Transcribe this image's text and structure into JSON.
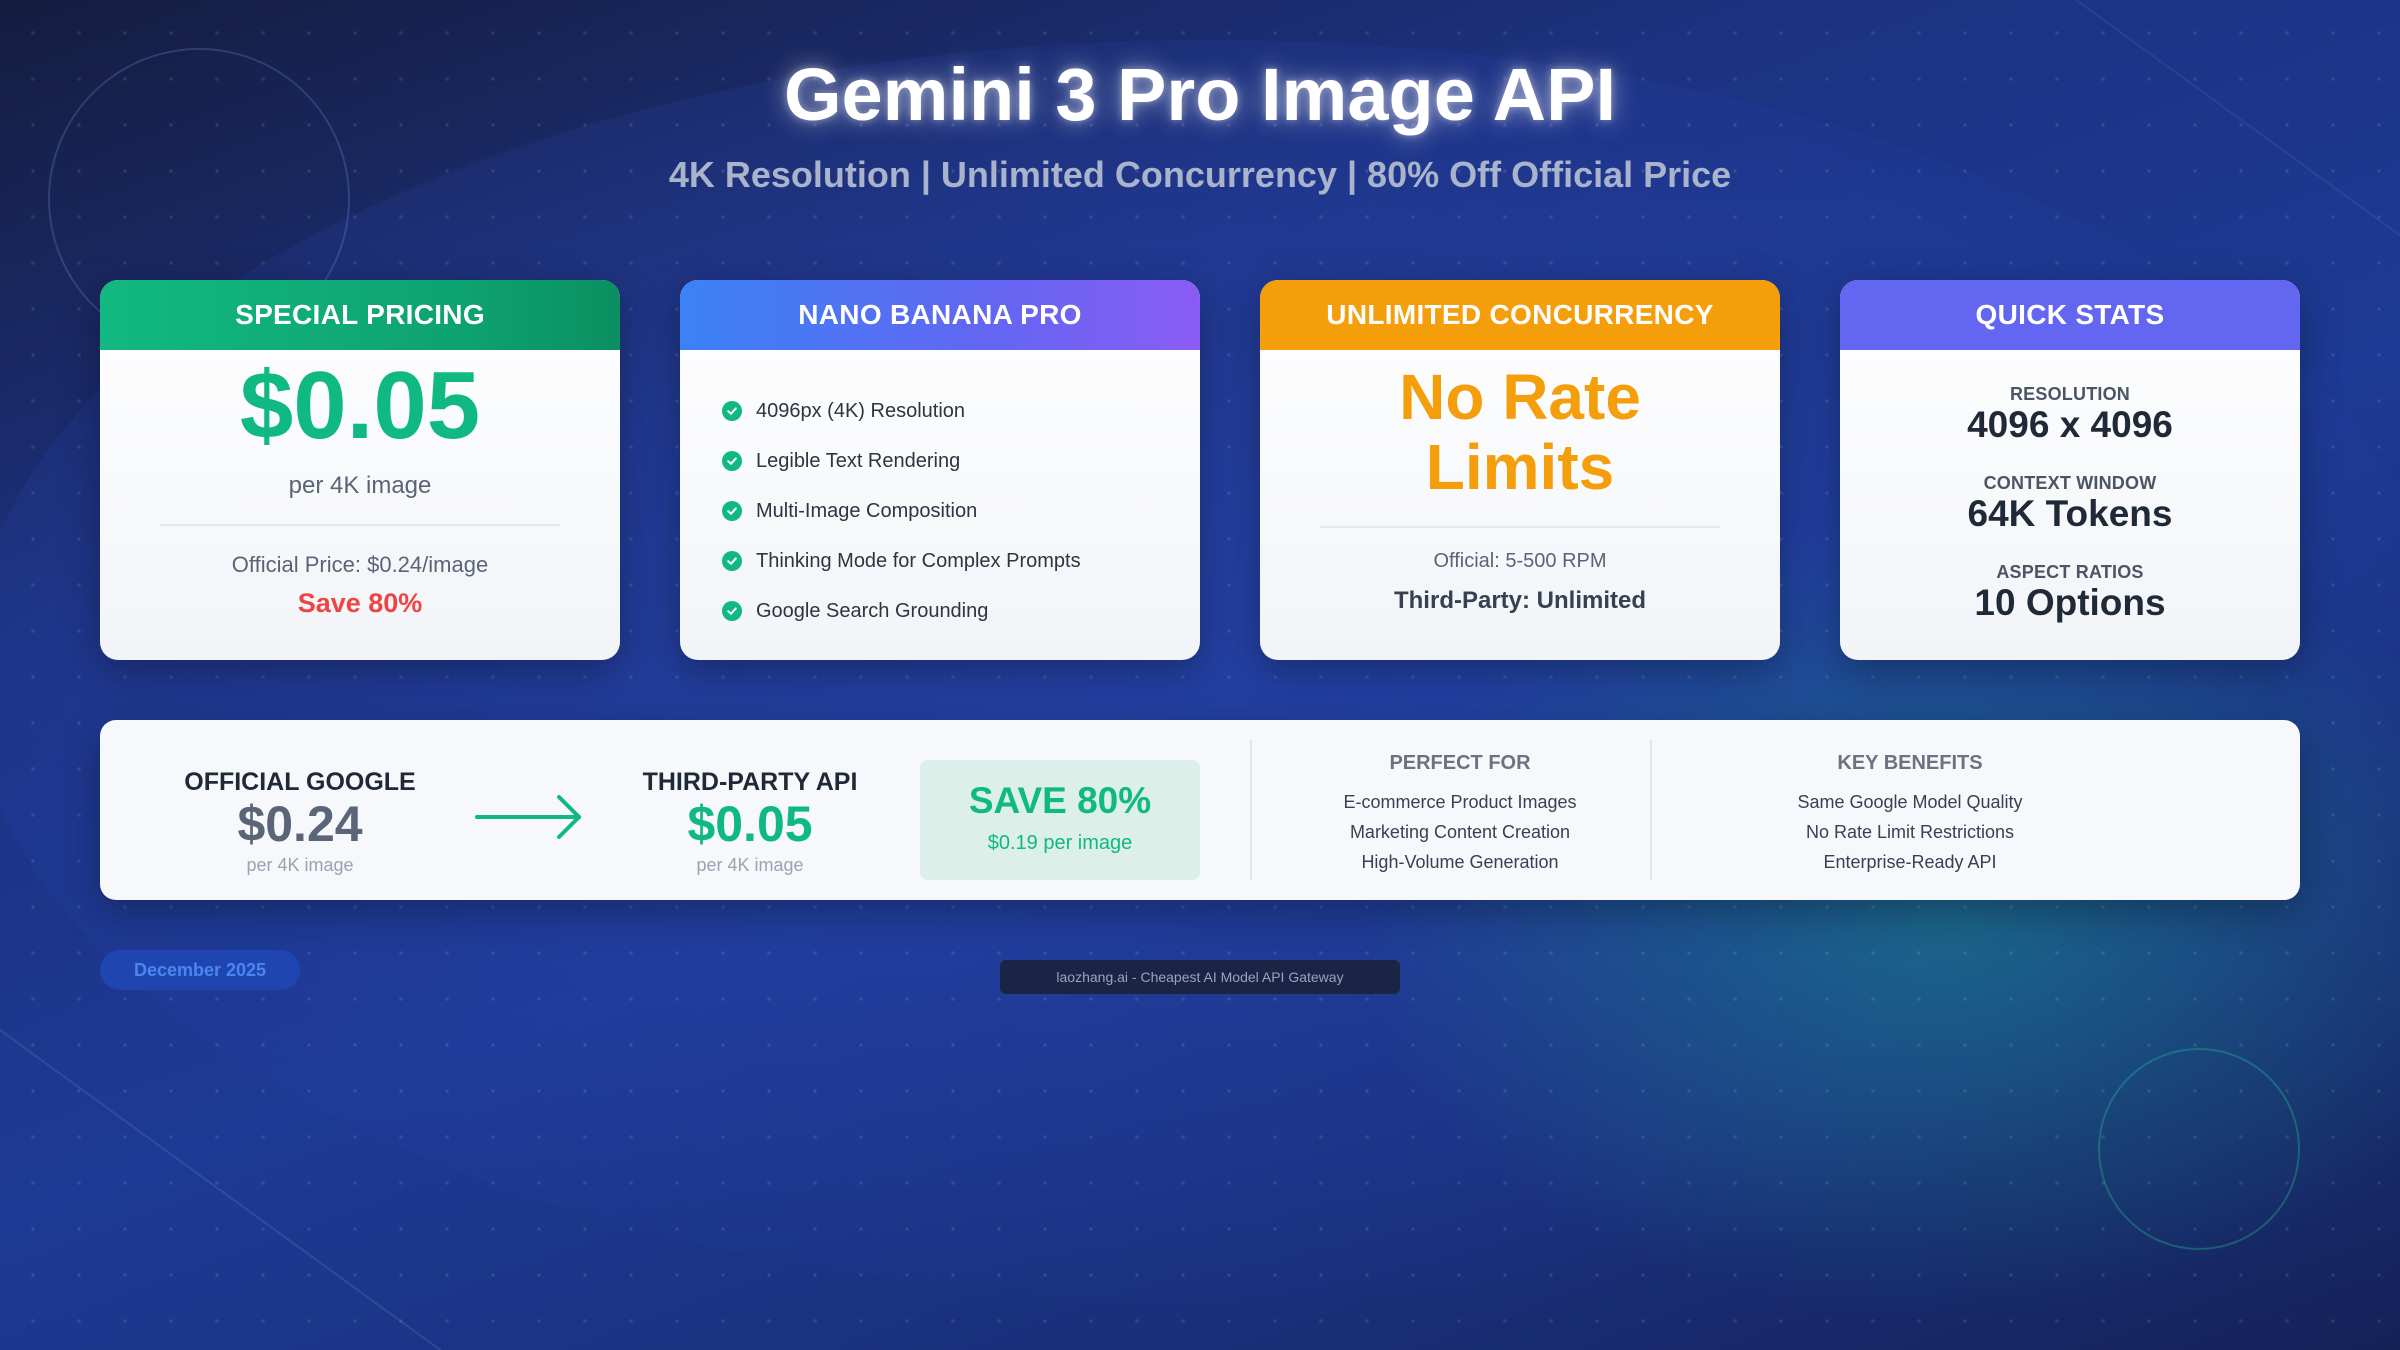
{
  "header": {
    "title": "Gemini 3 Pro Image API",
    "subtitle": "4K Resolution | Unlimited Concurrency | 80% Off Official Price"
  },
  "cards": {
    "pricing": {
      "heading": "SPECIAL PRICING",
      "price": "$0.05",
      "unit": "per 4K image",
      "official": "Official Price: $0.24/image",
      "save": "Save 80%"
    },
    "nano": {
      "heading": "NANO BANANA PRO",
      "features": [
        "4096px (4K) Resolution",
        "Legible Text Rendering",
        "Multi-Image Composition",
        "Thinking Mode for Complex Prompts",
        "Google Search Grounding"
      ]
    },
    "concurrency": {
      "heading": "UNLIMITED CONCURRENCY",
      "line1": "No Rate",
      "line2": "Limits",
      "official": "Official: 5-500 RPM",
      "third_party": "Third-Party: Unlimited"
    },
    "stats": {
      "heading": "QUICK STATS",
      "items": [
        {
          "label": "RESOLUTION",
          "value": "4096 x 4096"
        },
        {
          "label": "CONTEXT WINDOW",
          "value": "64K Tokens"
        },
        {
          "label": "ASPECT RATIOS",
          "value": "10 Options"
        }
      ]
    }
  },
  "comparison": {
    "official": {
      "label": "OFFICIAL GOOGLE",
      "price": "$0.24",
      "unit": "per 4K image"
    },
    "third_party": {
      "label": "THIRD-PARTY API",
      "price": "$0.05",
      "unit": "per 4K image"
    },
    "save": {
      "headline": "SAVE 80%",
      "detail": "$0.19 per image"
    },
    "perfect_for": {
      "heading": "PERFECT FOR",
      "items": [
        "E-commerce Product Images",
        "Marketing Content Creation",
        "High-Volume Generation"
      ]
    },
    "benefits": {
      "heading": "KEY BENEFITS",
      "items": [
        "Same Google Model Quality",
        "No Rate Limit Restrictions",
        "Enterprise-Ready API"
      ]
    }
  },
  "footer": {
    "date": "December 2025",
    "credit": "laozhang.ai - Cheapest AI Model API Gateway"
  },
  "colors": {
    "green": "#10b981",
    "orange": "#f59e0b",
    "indigo": "#6366f1",
    "red": "#ef4444",
    "slate_price": "#5b6578"
  }
}
